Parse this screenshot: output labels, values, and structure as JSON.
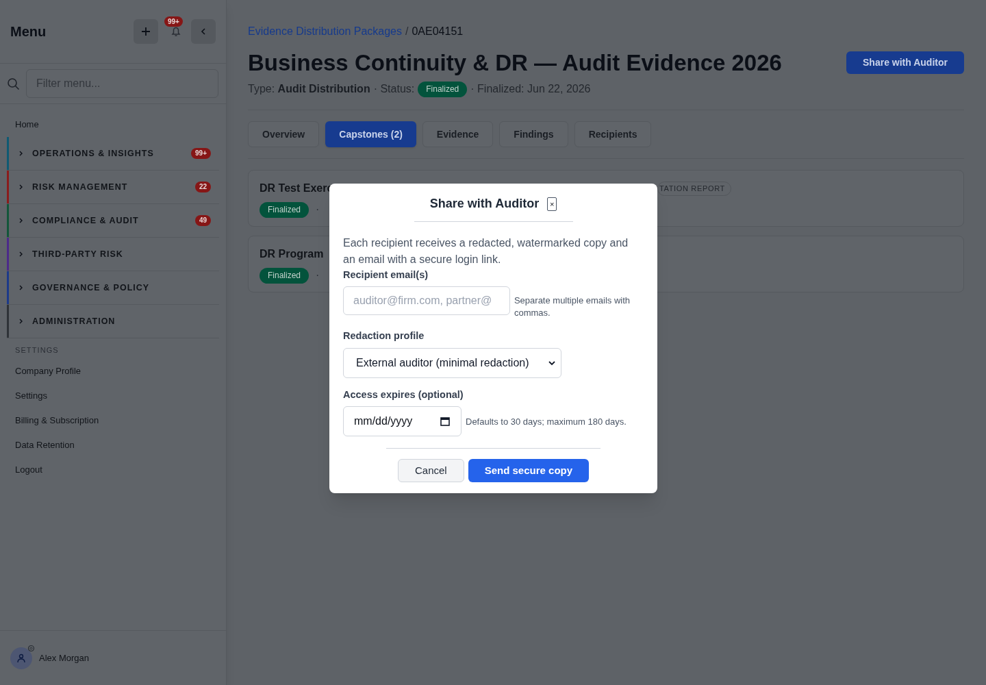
{
  "sidebar": {
    "title": "Menu",
    "notification_count": "99+",
    "filter": {
      "placeholder": "Filter menu..."
    },
    "items": [
      {
        "label": "Home",
        "kind": "link"
      },
      {
        "label": "OPERATIONS & INSIGHTS",
        "kind": "group",
        "color": "#0f5a73",
        "badge": "99+",
        "expanded": false
      },
      {
        "label": "RISK MANAGEMENT",
        "kind": "group",
        "color": "#8a1c1c",
        "badge": "22",
        "expanded": false
      },
      {
        "label": "COMPLIANCE & AUDIT",
        "kind": "group",
        "color": "#12573a",
        "badge": "49",
        "expanded": false
      },
      {
        "label": "THIRD-PARTY RISK",
        "kind": "group",
        "color": "#4c2a8a",
        "expanded": false
      },
      {
        "label": "GOVERNANCE & POLICY",
        "kind": "group",
        "color": "#1d3a8a",
        "expanded": false
      },
      {
        "label": "ADMINISTRATION",
        "kind": "group",
        "color": "#2f3338",
        "expanded": false
      },
      {
        "label": "SETTINGS",
        "kind": "heading"
      },
      {
        "label": "Company Profile",
        "kind": "link"
      },
      {
        "label": "Settings",
        "kind": "link"
      },
      {
        "label": "Billing & Subscription",
        "kind": "link"
      },
      {
        "label": "Data Retention",
        "kind": "link"
      },
      {
        "label": "Logout",
        "kind": "link"
      }
    ],
    "user": {
      "name": "Alex Morgan"
    }
  },
  "breadcrumb": {
    "parent": "Evidence Distribution Packages",
    "separator": "/",
    "current": "0AE04151"
  },
  "page": {
    "title": "Business Continuity & DR — Audit Evidence 2026",
    "action": "Share with Auditor",
    "meta": {
      "type_label": "Type:",
      "type": "Audit Distribution",
      "status_label": "· Status:",
      "status": "Finalized",
      "finalized": "· Finalized: Jun 22, 2026"
    }
  },
  "tabs": [
    {
      "label": "Overview",
      "selected": false
    },
    {
      "label": "Capstones (2)",
      "selected": true
    },
    {
      "label": "Evidence",
      "selected": false
    },
    {
      "label": "Findings",
      "selected": false
    },
    {
      "label": "Recipients",
      "selected": false
    }
  ],
  "capstones": [
    {
      "title": "DR Test Exerc",
      "status": "Finalized",
      "separator": "·",
      "tag": "TATION REPORT"
    },
    {
      "title": "DR Program",
      "status": "Finalized",
      "separator": "·"
    }
  ],
  "modal": {
    "title": "Share with Auditor",
    "close": "×",
    "description": "Each recipient receives a redacted, watermarked copy and an email with a secure login link.",
    "email": {
      "label": "Recipient email(s)",
      "placeholder": "auditor@firm.com, partner@",
      "hint": "Separate multiple emails with commas."
    },
    "redaction": {
      "label": "Redaction profile",
      "value": "External auditor (minimal redaction)"
    },
    "expires": {
      "label": "Access expires (optional)",
      "placeholder": "mm/dd/yyyy",
      "hint": "Defaults to 30 days; maximum 180 days."
    },
    "buttons": [
      {
        "label": "Cancel",
        "kind": "secondary"
      },
      {
        "label": "Send secure copy",
        "kind": "primary"
      }
    ]
  }
}
